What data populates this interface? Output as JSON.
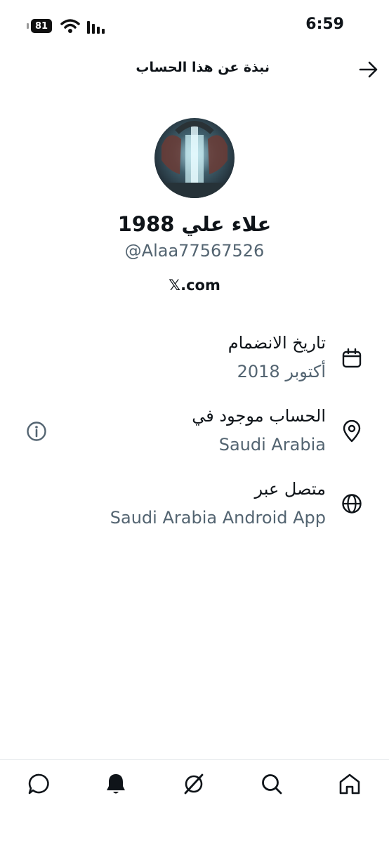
{
  "status_bar": {
    "battery": "81",
    "time": "6:59"
  },
  "header": {
    "title": "نبذة عن هذا الحساب",
    "back_icon": "arrow-right-icon"
  },
  "profile": {
    "display_name": "علاء علي 1988",
    "handle": "@Alaa77567526",
    "site": "𝕏.com"
  },
  "details": [
    {
      "icon": "calendar-icon",
      "title": "تاريخ الانضمام",
      "value": "أكتوبر 2018"
    },
    {
      "icon": "location-pin-icon",
      "title": "الحساب موجود في",
      "value": "Saudi Arabia",
      "info_icon": "info-icon"
    },
    {
      "icon": "globe-icon",
      "title": "متصل عبر",
      "value": "Saudi Arabia Android App"
    }
  ],
  "bottom_nav": [
    "messages-icon",
    "notifications-icon",
    "grok-icon",
    "search-icon",
    "home-icon"
  ],
  "colors": {
    "text": "#0f1419",
    "secondary": "#536471",
    "divider": "#e4e8eb"
  }
}
